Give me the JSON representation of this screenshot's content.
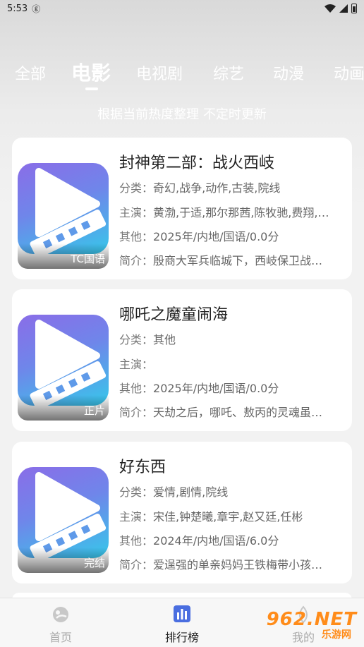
{
  "status": {
    "time": "5:53",
    "sync_glyph": "ⓖ"
  },
  "tabs": [
    {
      "label": "全部"
    },
    {
      "label": "电影"
    },
    {
      "label": "电视剧"
    },
    {
      "label": "综艺"
    },
    {
      "label": "动漫"
    },
    {
      "label": "动画"
    }
  ],
  "active_tab": "电影",
  "subtitle": "根据当前热度整理 不定时更新",
  "labels": {
    "category": "分类：",
    "cast": "主演：",
    "other": "其他：",
    "intro": "简介："
  },
  "movies": [
    {
      "title": "封神第二部：战火西岐",
      "badge": "TC国语",
      "category": "奇幻,战争,动作,古装,院线",
      "cast": "黄渤,于适,那尔那茜,陈牧驰,费翔,…",
      "other": "2025年/内地/国语/0.0分",
      "intro": "殷商大军兵临城下，西岐保卫战…"
    },
    {
      "title": "哪吒之魔童闹海",
      "badge": "正片",
      "category": "其他",
      "cast": "",
      "other": "2025年/内地/国语/0.0分",
      "intro": "天劫之后，哪吒、敖丙的灵魂虽…"
    },
    {
      "title": "好东西",
      "badge": "完结",
      "category": "爱情,剧情,院线",
      "cast": "宋佳,钟楚曦,章宇,赵又廷,任彬",
      "other": "2024年/内地/国语/6.0分",
      "intro": "爱逞强的单亲妈妈王铁梅带小孩…"
    }
  ],
  "nav": {
    "home": "首页",
    "rank": "排行榜",
    "third": "我的"
  },
  "watermark": {
    "number": "962.NET",
    "text": "乐游网"
  },
  "colors": {
    "poster_top": "#8a6de8",
    "poster_bottom": "#36c8ea",
    "watermark": "#ff8c1a"
  }
}
